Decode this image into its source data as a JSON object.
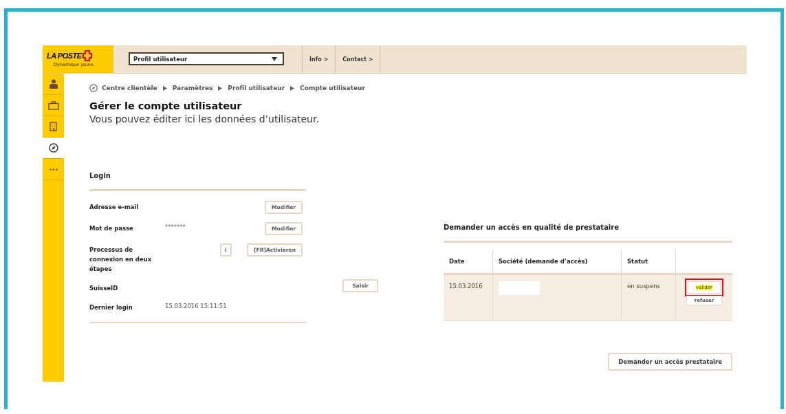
{
  "logo": {
    "brand": "LA POSTE",
    "tagline": "Dynamique jaune."
  },
  "header": {
    "profile_select": "Profil utilisateur",
    "nav": [
      "Info >",
      "Contact >"
    ]
  },
  "sidebar": {
    "items": [
      {
        "kind": "person",
        "selected": false
      },
      {
        "kind": "briefcase",
        "selected": false
      },
      {
        "kind": "building",
        "selected": false
      },
      {
        "kind": "compass",
        "selected": true
      },
      {
        "kind": "more",
        "selected": false
      }
    ]
  },
  "breadcrumb": [
    "Centre clientèle",
    "Paramètres",
    "Profil utilisateur",
    "Compte utilisateur"
  ],
  "page": {
    "title": "Gérer le compte utilisateur",
    "subtitle": "Vous pouvez éditer ici les données d’utilisateur."
  },
  "login": {
    "title": "Login",
    "rows": [
      {
        "kind": "button",
        "label": "Adresse e-mail",
        "button": "Modifier"
      },
      {
        "kind": "button",
        "label": "Mot de passe",
        "value": "*******",
        "button": "Modifier"
      },
      {
        "kind": "info",
        "label": "Processus de connexion en deux étapes",
        "info": "i",
        "button": "[FR]Activieren"
      },
      {
        "kind": "far",
        "label": "SuisseID",
        "button": "Saisir"
      },
      {
        "kind": "text",
        "label": "Dernier login",
        "value": "15.03.2016 15:11:51"
      }
    ]
  },
  "provider": {
    "title": "Demander un accès en qualité de prestataire",
    "columns": [
      "Date",
      "Société (demande d’accès)",
      "Statut"
    ],
    "rows": [
      {
        "date": "15.03.2016",
        "status": "en suspens",
        "actions": [
          {
            "label": "valider",
            "highlighted": true
          },
          {
            "label": "refuser",
            "highlighted": false
          }
        ]
      }
    ],
    "request_button": "Demander un accès prestataire"
  }
}
